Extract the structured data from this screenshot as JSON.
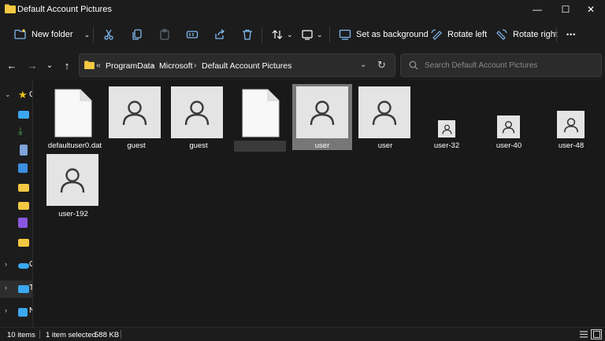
{
  "window": {
    "title": "Default Account Pictures",
    "minimize_glyph": "—",
    "maximize_glyph": "☐",
    "close_glyph": "✕"
  },
  "toolbar": {
    "new_folder_label": "New folder",
    "set_background_label": "Set as background",
    "rotate_left_label": "Rotate left",
    "rotate_right_label": "Rotate right",
    "more_glyph": "•••",
    "icons": [
      "new-folder-icon",
      "cut-icon",
      "copy-icon",
      "paste-icon",
      "rename-icon",
      "share-icon",
      "delete-icon",
      "sort-icon",
      "view-icon",
      "set-background-icon",
      "rotate-left-icon",
      "rotate-right-icon",
      "more-icon"
    ]
  },
  "address": {
    "overflow": "«",
    "crumbs": [
      "ProgramData",
      "Microsoft",
      "Default Account Pictures"
    ],
    "separator": "›"
  },
  "search": {
    "placeholder": "Search Default Account Pictures"
  },
  "sidebar": {
    "items": [
      {
        "icon": "star-icon",
        "color": "#f5c518",
        "letter": "C",
        "expanded": true
      },
      {
        "icon": "desktop-icon",
        "color": "#3ba7f0"
      },
      {
        "icon": "downloads-icon",
        "color": "#4caf50"
      },
      {
        "icon": "documents-icon",
        "color": "#7fa4d8"
      },
      {
        "icon": "pictures-icon",
        "color": "#3b8fe0"
      },
      {
        "icon": "folder-icon",
        "color": "#f4c842"
      },
      {
        "icon": "folder-icon",
        "color": "#f4c842"
      },
      {
        "icon": "videos-icon",
        "color": "#8a56e0"
      },
      {
        "icon": "folder-icon",
        "color": "#f4c842"
      },
      {
        "icon": "onedrive-icon",
        "color": "#3ba7f0",
        "letter": "O"
      },
      {
        "icon": "this-pc-icon",
        "color": "#3ba7f0",
        "letter": "T"
      },
      {
        "icon": "network-icon",
        "color": "#3ba7f0",
        "letter": "N"
      }
    ]
  },
  "files": [
    {
      "name": "defaultuser0.dat",
      "type": "document"
    },
    {
      "name": "guest",
      "type": "image"
    },
    {
      "name": "guest",
      "type": "image"
    },
    {
      "name": "",
      "type": "document",
      "blurred_name": true
    },
    {
      "name": "user",
      "type": "image",
      "selected": true
    },
    {
      "name": "user",
      "type": "image"
    },
    {
      "name": "user-32",
      "type": "image"
    },
    {
      "name": "user-40",
      "type": "image"
    },
    {
      "name": "user-48",
      "type": "image"
    },
    {
      "name": "user-192",
      "type": "image"
    }
  ],
  "status": {
    "item_count": "10 items",
    "selection": "1 item selected",
    "size": "588 KB"
  },
  "colors": {
    "background": "#1c1c1c",
    "content": "#191919",
    "thumbnail": "#e4e4e4",
    "selection": "#777777",
    "folder": "#f4c842"
  }
}
